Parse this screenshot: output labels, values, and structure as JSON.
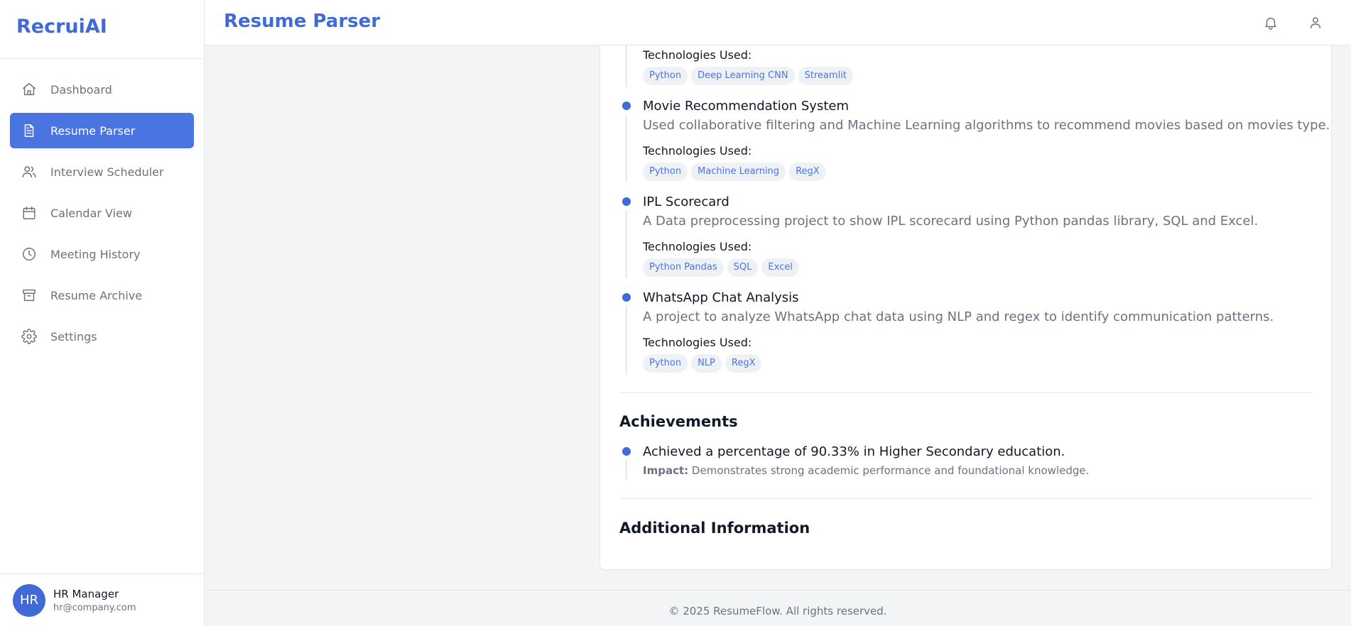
{
  "app": {
    "brand": "RecruiAI"
  },
  "sidebar": {
    "items": [
      {
        "label": "Dashboard",
        "icon": "home-icon"
      },
      {
        "label": "Resume Parser",
        "icon": "document-icon",
        "active": true
      },
      {
        "label": "Interview Scheduler",
        "icon": "users-icon"
      },
      {
        "label": "Calendar View",
        "icon": "calendar-icon"
      },
      {
        "label": "Meeting History",
        "icon": "clock-icon"
      },
      {
        "label": "Resume Archive",
        "icon": "archive-icon"
      },
      {
        "label": "Settings",
        "icon": "gear-icon"
      }
    ],
    "user": {
      "initials": "HR",
      "name": "HR Manager",
      "email": "hr@company.com"
    }
  },
  "header": {
    "title": "Resume Parser",
    "icons": [
      "bell-icon",
      "user-icon"
    ]
  },
  "projects": {
    "tech_label": "Technologies Used:",
    "items": [
      {
        "title": "",
        "description": "",
        "tags": [
          "Python",
          "Deep Learning CNN",
          "Streamlit"
        ]
      },
      {
        "title": "Movie Recommendation System",
        "description": "Used collaborative filtering and Machine Learning algorithms to recommend movies based on movies type.",
        "tags": [
          "Python",
          "Machine Learning",
          "RegX"
        ]
      },
      {
        "title": "IPL Scorecard",
        "description": "A Data preprocessing project to show IPL scorecard using Python pandas library, SQL and Excel.",
        "tags": [
          "Python Pandas",
          "SQL",
          "Excel"
        ]
      },
      {
        "title": "WhatsApp Chat Analysis",
        "description": "A project to analyze WhatsApp chat data using NLP and regex to identify communication patterns.",
        "tags": [
          "Python",
          "NLP",
          "RegX"
        ]
      }
    ]
  },
  "achievements": {
    "title": "Achievements",
    "items": [
      {
        "text": "Achieved a percentage of 90.33% in Higher Secondary education.",
        "impact_label": "Impact:",
        "impact": "Demonstrates strong academic performance and foundational knowledge."
      }
    ]
  },
  "additional": {
    "title": "Additional Information"
  },
  "footer": {
    "text": "© 2025 ResumeFlow. All rights reserved."
  },
  "colors": {
    "accent": "#3f6ad8",
    "active_bg": "#4a74df",
    "tag_bg": "#eef2f7"
  }
}
